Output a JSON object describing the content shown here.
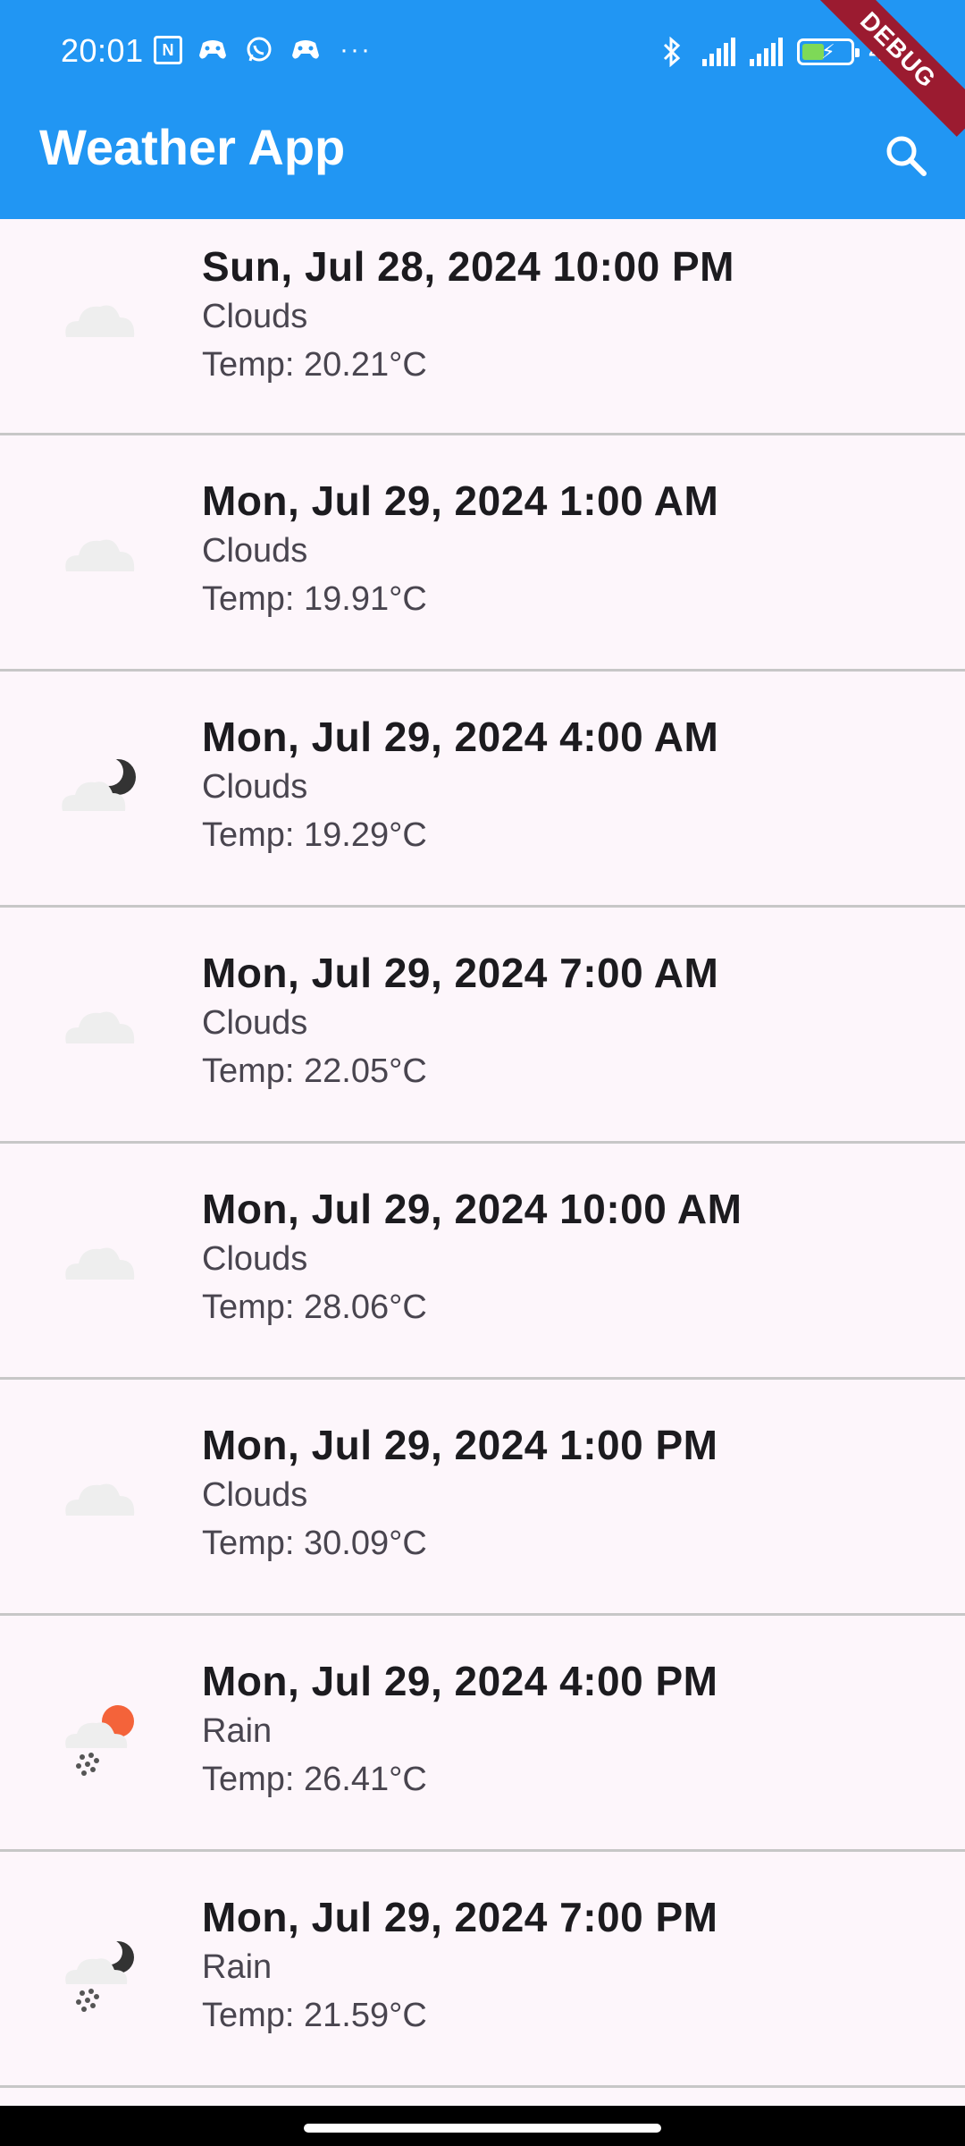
{
  "status_bar": {
    "time": "20:01",
    "nfc_label": "N",
    "battery_level": "40",
    "icons": [
      "nfc-icon",
      "game-controller-icon",
      "whatsapp-icon",
      "game-controller-icon",
      "more-dots-icon",
      "bluetooth-icon",
      "signal-icon",
      "signal-icon",
      "battery-charging-icon"
    ]
  },
  "app_bar": {
    "title": "Weather App",
    "search_icon": "search-icon",
    "debug_banner": "DEBUG",
    "color": "#2196f3"
  },
  "forecast": [
    {
      "datetime": "Sun, Jul 28, 2024 10:00 PM",
      "condition": "Clouds",
      "temp": "Temp: 20.21°C",
      "icon": "cloud-icon"
    },
    {
      "datetime": "Mon, Jul 29, 2024 1:00 AM",
      "condition": "Clouds",
      "temp": "Temp: 19.91°C",
      "icon": "cloud-icon"
    },
    {
      "datetime": "Mon, Jul 29, 2024 4:00 AM",
      "condition": "Clouds",
      "temp": "Temp: 19.29°C",
      "icon": "cloud-moon-icon"
    },
    {
      "datetime": "Mon, Jul 29, 2024 7:00 AM",
      "condition": "Clouds",
      "temp": "Temp: 22.05°C",
      "icon": "cloud-icon"
    },
    {
      "datetime": "Mon, Jul 29, 2024 10:00 AM",
      "condition": "Clouds",
      "temp": "Temp: 28.06°C",
      "icon": "cloud-icon"
    },
    {
      "datetime": "Mon, Jul 29, 2024 1:00 PM",
      "condition": "Clouds",
      "temp": "Temp: 30.09°C",
      "icon": "cloud-icon"
    },
    {
      "datetime": "Mon, Jul 29, 2024 4:00 PM",
      "condition": "Rain",
      "temp": "Temp: 26.41°C",
      "icon": "rain-sun-icon"
    },
    {
      "datetime": "Mon, Jul 29, 2024 7:00 PM",
      "condition": "Rain",
      "temp": "Temp: 21.59°C",
      "icon": "rain-moon-icon"
    }
  ]
}
